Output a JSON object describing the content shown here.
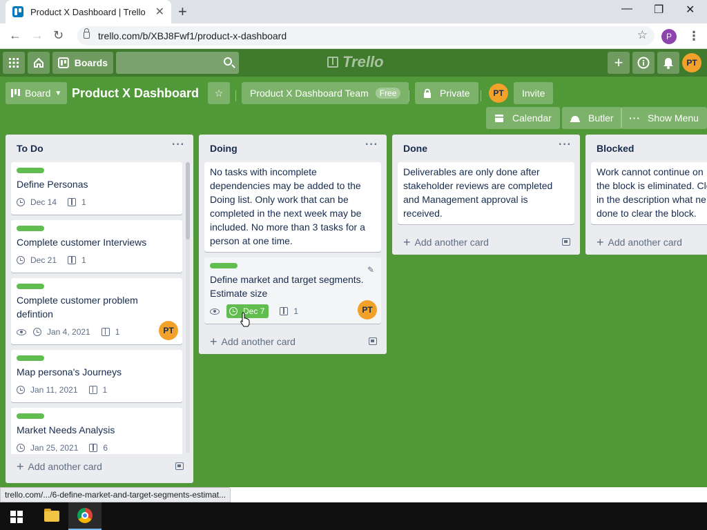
{
  "browser": {
    "tab_title": "Product X Dashboard | Trello",
    "tab_close": "✕",
    "new_tab": "+",
    "url": "trello.com/b/XBJ8Fwf1/product-x-dashboard",
    "profile_initial": "P",
    "status_url": "trello.com/.../6-define-market-and-target-segments-estimat..."
  },
  "topnav": {
    "boards_label": "Boards",
    "logo_text": "Trello",
    "user_initials": "PT"
  },
  "board": {
    "board_menu_label": "Board",
    "title": "Product X Dashboard",
    "team_name": "Product X Dashboard Team",
    "team_plan": "Free",
    "visibility": "Private",
    "member_initials": "PT",
    "invite_label": "Invite",
    "calendar_label": "Calendar",
    "butler_label": "Butler",
    "show_menu_label": "Show Menu"
  },
  "add_card_label": "Add another card",
  "lists": [
    {
      "title": "To Do",
      "cards": [
        {
          "title": "Define Personas",
          "due": "Dec 14",
          "checklist": "1"
        },
        {
          "title": "Complete customer Interviews",
          "due": "Dec 21",
          "checklist": "1"
        },
        {
          "title": "Complete customer problem defintion",
          "due": "Jan 4, 2021",
          "checklist": "1",
          "member": "PT"
        },
        {
          "title": "Map persona's Journeys",
          "due": "Jan 11, 2021",
          "checklist": "1"
        },
        {
          "title": "Market Needs Analysis",
          "due": "Jan 25, 2021",
          "checklist": "6"
        }
      ]
    },
    {
      "title": "Doing",
      "cards": [
        {
          "title": "No tasks with incomplete dependencies may be added to the Doing list. Only work that can be completed in the next week may be included. No more than 3 tasks for a person at one time."
        },
        {
          "title": "Define market and target segments. Estimate size",
          "due": "Dec 7",
          "checklist": "1",
          "member": "PT"
        }
      ]
    },
    {
      "title": "Done",
      "cards": [
        {
          "title": "Deliverables are only done after stakeholder reviews are completed and Management approval is received."
        }
      ]
    },
    {
      "title": "Blocked",
      "cards": [
        {
          "title": "Work cannot continue on the block is eliminated. Cle in the description what ne done to clear the block."
        }
      ]
    }
  ],
  "colors": {
    "board_bg": "#519839",
    "nav_bg": "#3f7a2d",
    "label_green": "#61bd4f",
    "avatar_orange": "#f2a22b"
  }
}
